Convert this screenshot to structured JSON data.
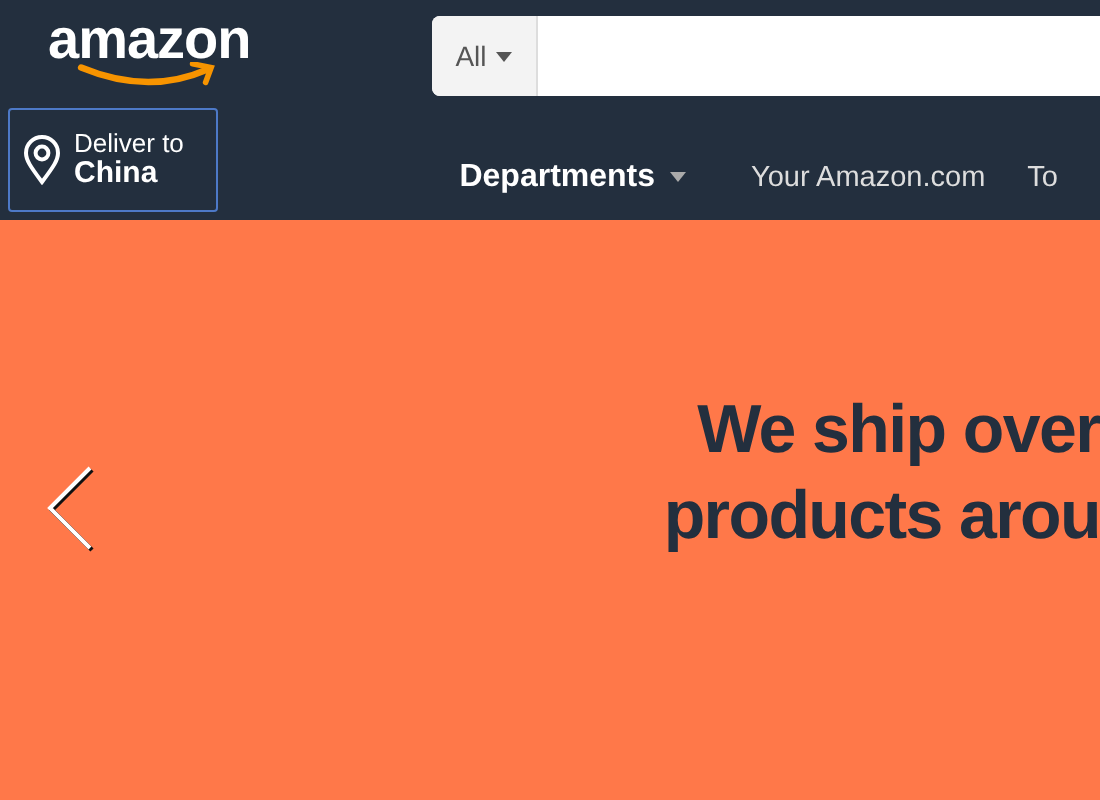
{
  "header": {
    "logo": "amazon",
    "search": {
      "category": "All"
    },
    "deliver": {
      "label": "Deliver to",
      "country": "China"
    },
    "nav": [
      {
        "label": "Departments",
        "kind": "dropdown"
      },
      {
        "label": "Your Amazon.com",
        "kind": "link"
      },
      {
        "label": "To",
        "kind": "link"
      }
    ]
  },
  "banner": {
    "lines": [
      "We ship over",
      "products arou"
    ]
  }
}
